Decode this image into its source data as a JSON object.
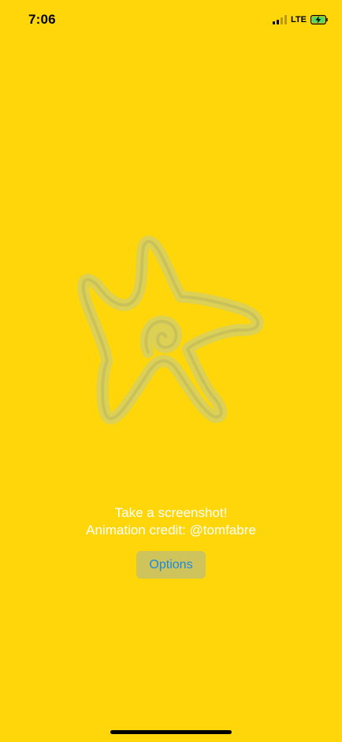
{
  "status_bar": {
    "time": "7:06",
    "network": "LTE",
    "signal_icon": "cellular-signal-icon",
    "battery_icon": "battery-charging-icon"
  },
  "main": {
    "animation_icon": "starfish-icon",
    "line1": "Take a screenshot!",
    "line2": "Animation credit: @tomfabre",
    "options_label": "Options"
  },
  "colors": {
    "background": "#FFD60A",
    "starfish_stroke": "#D4CC5A",
    "button_bg": "#CFC35C",
    "button_text": "#1A8AE0",
    "caption_text": "#FFFFFF",
    "battery_fill": "#4CD964"
  }
}
